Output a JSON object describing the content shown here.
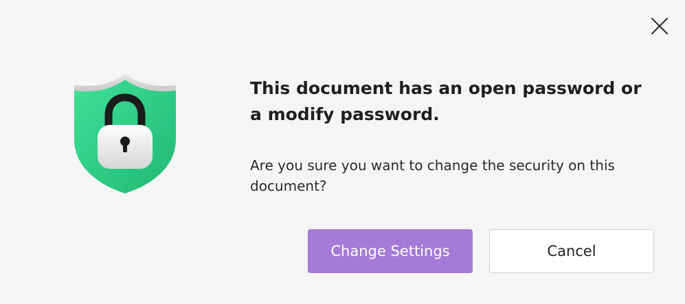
{
  "dialog": {
    "heading": "This document has an open password or a modify password.",
    "message": "Are you sure you want to change the security on this document?",
    "close_icon": "close-icon",
    "illustration_icon": "shield-lock-icon"
  },
  "buttons": {
    "primary_label": "Change Settings",
    "secondary_label": "Cancel"
  },
  "colors": {
    "primary_button": "#a57ad8",
    "shield_green": "#2ecf85",
    "background": "#f5f5f5"
  }
}
